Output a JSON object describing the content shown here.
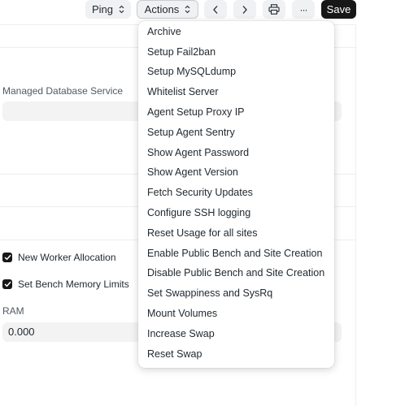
{
  "toolbar": {
    "ping_label": "Ping",
    "actions_label": "Actions",
    "save_label": "Save",
    "more_label": "···"
  },
  "form": {
    "managed_db_label": "Managed Database Service",
    "managed_db_value": "",
    "new_worker_label": "New Worker Allocation",
    "new_worker_checked": true,
    "bench_memory_label": "Set Bench Memory Limits",
    "bench_memory_checked": true,
    "ram_label": "RAM",
    "ram_value": "0.000"
  },
  "actions_menu": {
    "items": [
      "Archive",
      "Setup Fail2ban",
      "Setup MySQLdump",
      "Whitelist Server",
      "Agent Setup Proxy IP",
      "Setup Agent Sentry",
      "Show Agent Password",
      "Show Agent Version",
      "Fetch Security Updates",
      "Configure SSH logging",
      "Reset Usage for all sites",
      "Enable Public Bench and Site Creation",
      "Disable Public Bench and Site Creation",
      "Set Swappiness and SysRq",
      "Mount Volumes",
      "Increase Swap",
      "Reset Swap"
    ]
  }
}
